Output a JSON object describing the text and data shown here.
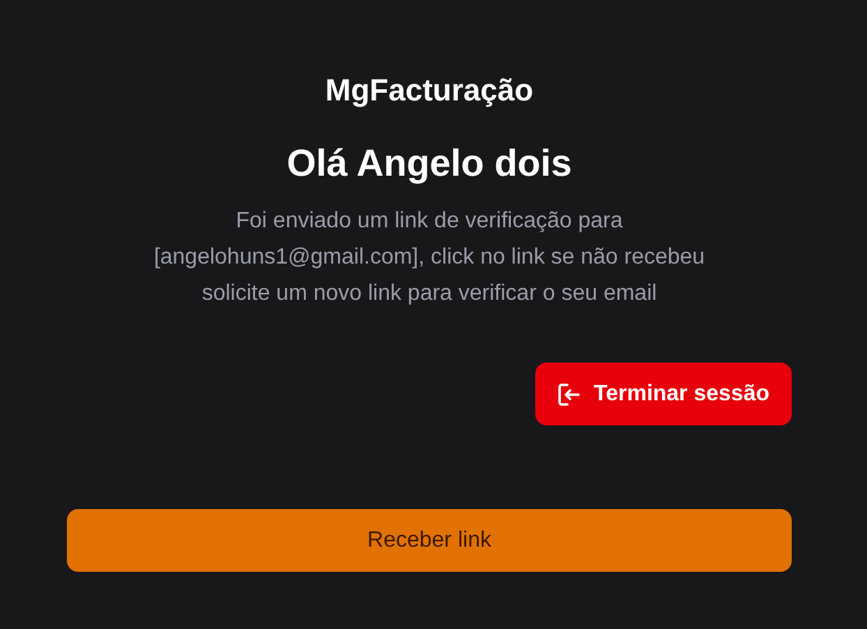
{
  "app_title": "MgFacturação",
  "greeting": "Olá Angelo dois",
  "message": "Foi enviado um link de verificação para [angelohuns1@gmail.com], click no link se não recebeu solicite um novo link para verificar o seu email",
  "buttons": [
    {
      "kind": "logout",
      "label": "Terminar sessão"
    },
    {
      "kind": "primary",
      "label": "Receber link"
    }
  ]
}
